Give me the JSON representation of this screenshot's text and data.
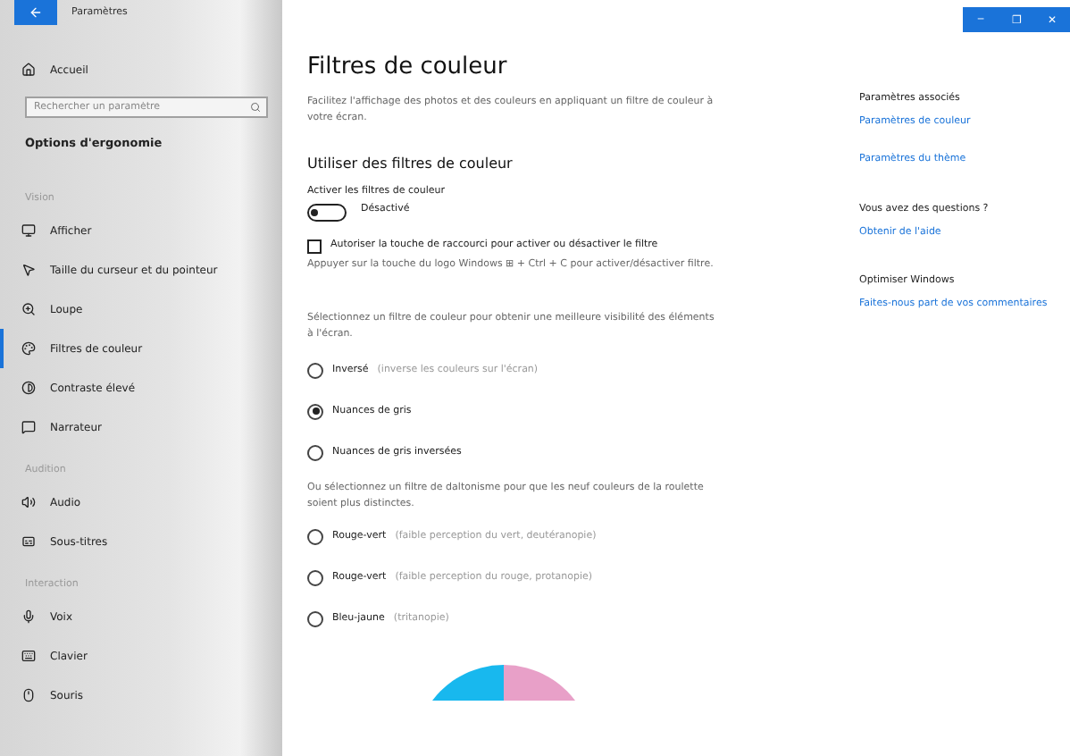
{
  "window": {
    "title": "Paramètres",
    "controls": [
      "–",
      "❐",
      "✕"
    ]
  },
  "sidebar": {
    "home": "Accueil",
    "search": {
      "placeholder": "Rechercher un paramètre"
    },
    "heading": "Options d'ergonomie",
    "sections": [
      {
        "title": "Vision",
        "items": [
          {
            "label": "Afficher",
            "selected": false
          },
          {
            "label": "Taille du curseur et du pointeur",
            "selected": false
          },
          {
            "label": "Loupe",
            "selected": false
          },
          {
            "label": "Filtres de couleur",
            "selected": true
          },
          {
            "label": "Contraste élevé",
            "selected": false
          },
          {
            "label": "Narrateur",
            "selected": false
          }
        ]
      },
      {
        "title": "Audition",
        "items": [
          {
            "label": "Audio",
            "selected": false
          },
          {
            "label": "Sous-titres",
            "selected": false
          }
        ]
      },
      {
        "title": "Interaction",
        "items": [
          {
            "label": "Voix",
            "selected": false
          },
          {
            "label": "Clavier",
            "selected": false
          },
          {
            "label": "Souris",
            "selected": false
          }
        ]
      }
    ]
  },
  "main": {
    "title": "Filtres de couleur",
    "description": "Facilitez l'affichage des photos et des couleurs en appliquant un filtre de couleur à votre écran.",
    "section_title": "Utiliser des filtres de couleur",
    "toggle": {
      "label": "Activer les filtres de couleur",
      "on": false,
      "state_text": "Désactivé"
    },
    "shortcut": {
      "label": "Autoriser la touche de raccourci pour activer ou désactiver le filtre",
      "checked": false,
      "hint": "Appuyer sur la touche du logo Windows ⊞ + Ctrl + C pour activer/désactiver filtre."
    },
    "filters_intro": "Sélectionnez un filtre de couleur pour obtenir une meilleure visibilité des éléments à l'écran.",
    "filters": [
      {
        "label": "Inversé",
        "note": "(inverse les couleurs sur l'écran)",
        "selected": false
      },
      {
        "label": "Nuances de gris",
        "selected": true
      },
      {
        "label": "Nuances de gris inversées",
        "selected": false
      }
    ],
    "colorblind_intro": "Ou sélectionnez un filtre de daltonisme pour que les neuf couleurs de la roulette soient plus distinctes.",
    "colorblind_filters": [
      {
        "label": "Rouge-vert",
        "note": "(faible perception du vert, deutéranopie)",
        "selected": false
      },
      {
        "label": "Rouge-vert",
        "note": "(faible perception du rouge, protanopie)",
        "selected": false
      },
      {
        "label": "Bleu-jaune",
        "note": "(tritanopie)",
        "selected": false
      }
    ]
  },
  "related": [
    {
      "heading": "Paramètres associés",
      "links": [
        "Paramètres de couleur",
        "Paramètres du thème"
      ]
    },
    {
      "heading": "Vous avez des questions ?",
      "links": [
        "Obtenir de l'aide"
      ]
    },
    {
      "heading": "Optimiser Windows",
      "links": [
        "Faites-nous part de vos commentaires"
      ]
    }
  ]
}
